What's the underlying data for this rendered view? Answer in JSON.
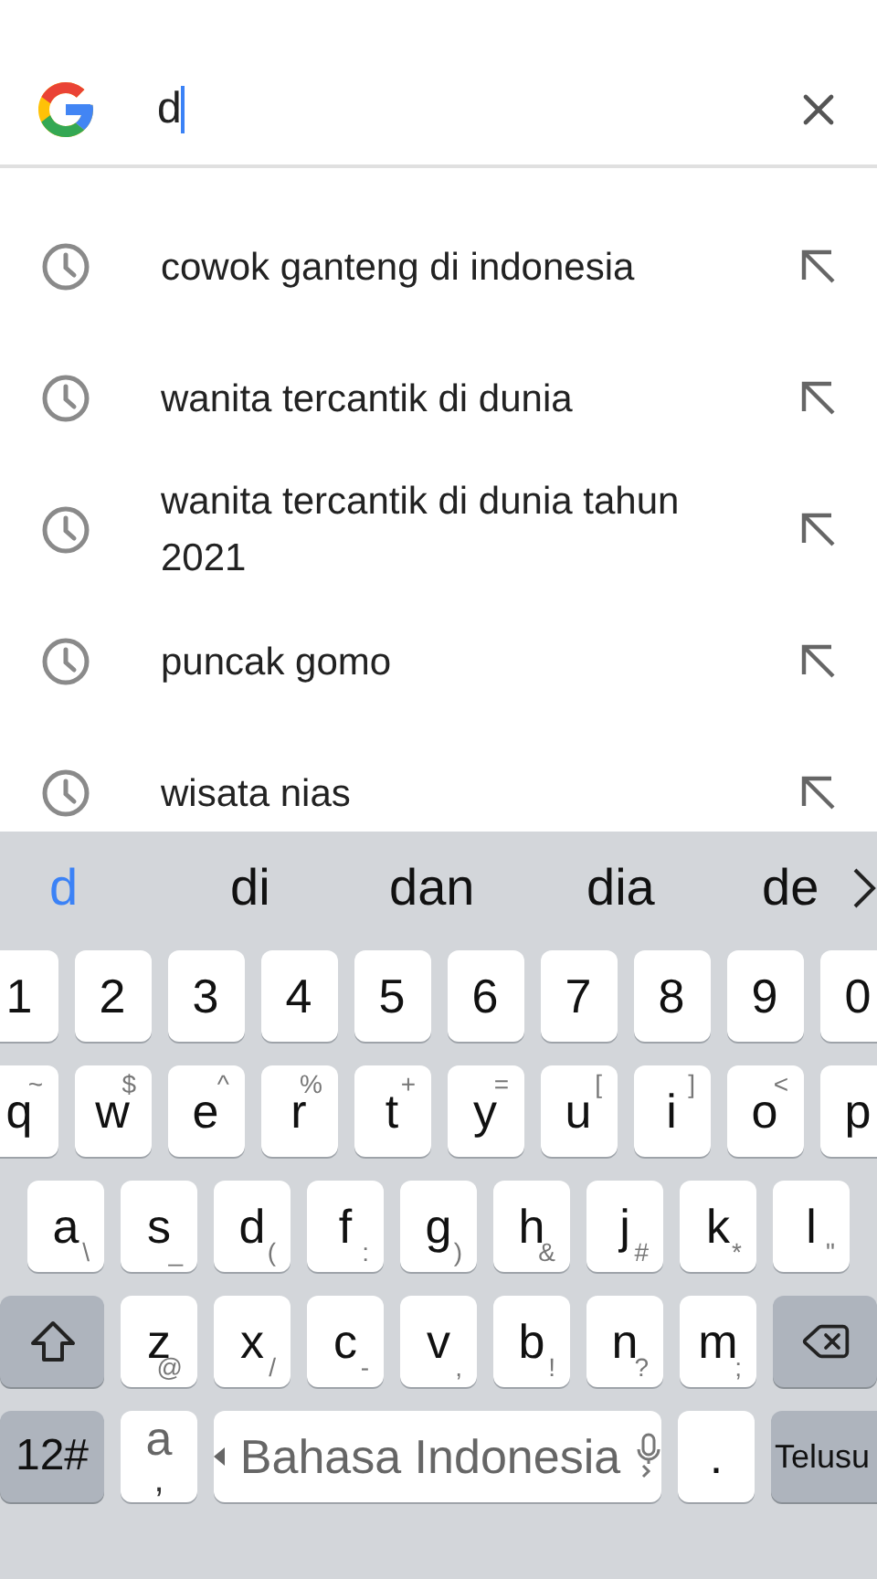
{
  "search": {
    "value": "d"
  },
  "suggestions": [
    {
      "text": "cowok ganteng di indonesia"
    },
    {
      "text": "wanita tercantik di dunia"
    },
    {
      "text": "wanita tercantik di dunia tahun 2021"
    },
    {
      "text": "puncak gomo"
    },
    {
      "text": "wisata nias"
    }
  ],
  "keyboard": {
    "candidates": [
      {
        "text": "d",
        "selected": true
      },
      {
        "text": "di",
        "selected": false
      },
      {
        "text": "dan",
        "selected": false
      },
      {
        "text": "dia",
        "selected": false
      },
      {
        "text": "de",
        "selected": false
      }
    ],
    "rows": [
      {
        "kind": "number",
        "keys": [
          {
            "main": "1"
          },
          {
            "main": "2"
          },
          {
            "main": "3"
          },
          {
            "main": "4"
          },
          {
            "main": "5"
          },
          {
            "main": "6"
          },
          {
            "main": "7"
          },
          {
            "main": "8"
          },
          {
            "main": "9"
          },
          {
            "main": "0"
          }
        ]
      },
      {
        "kind": "top",
        "keys": [
          {
            "main": "q",
            "alt": "~"
          },
          {
            "main": "w",
            "alt": "$"
          },
          {
            "main": "e",
            "alt": "^"
          },
          {
            "main": "r",
            "alt": "%"
          },
          {
            "main": "t",
            "alt": "+"
          },
          {
            "main": "y",
            "alt": "="
          },
          {
            "main": "u",
            "alt": "["
          },
          {
            "main": "i",
            "alt": "]"
          },
          {
            "main": "o",
            "alt": "<"
          },
          {
            "main": "p"
          }
        ]
      },
      {
        "kind": "bottom",
        "keys": [
          {
            "main": "a",
            "alt": "\\"
          },
          {
            "main": "s",
            "alt": "_"
          },
          {
            "main": "d",
            "alt": "("
          },
          {
            "main": "f",
            "alt": ":"
          },
          {
            "main": "g",
            "alt": ")"
          },
          {
            "main": "h",
            "alt": "&"
          },
          {
            "main": "j",
            "alt": "#"
          },
          {
            "main": "k",
            "alt": "*"
          },
          {
            "main": "l",
            "alt": "\""
          }
        ]
      },
      {
        "kind": "bottom",
        "keys": [
          {
            "main": "z",
            "alt": "@"
          },
          {
            "main": "x",
            "alt": "/"
          },
          {
            "main": "c",
            "alt": "-"
          },
          {
            "main": "v",
            "alt": ","
          },
          {
            "main": "b",
            "alt": "!"
          },
          {
            "main": "n",
            "alt": "?"
          },
          {
            "main": "m",
            "alt": ";"
          }
        ]
      }
    ],
    "symbols_key": "12#",
    "punct_key": {
      "main": "a",
      "alt": ","
    },
    "space_label": "Bahasa Indonesia",
    "period_key": ".",
    "search_key": "Telusu"
  }
}
